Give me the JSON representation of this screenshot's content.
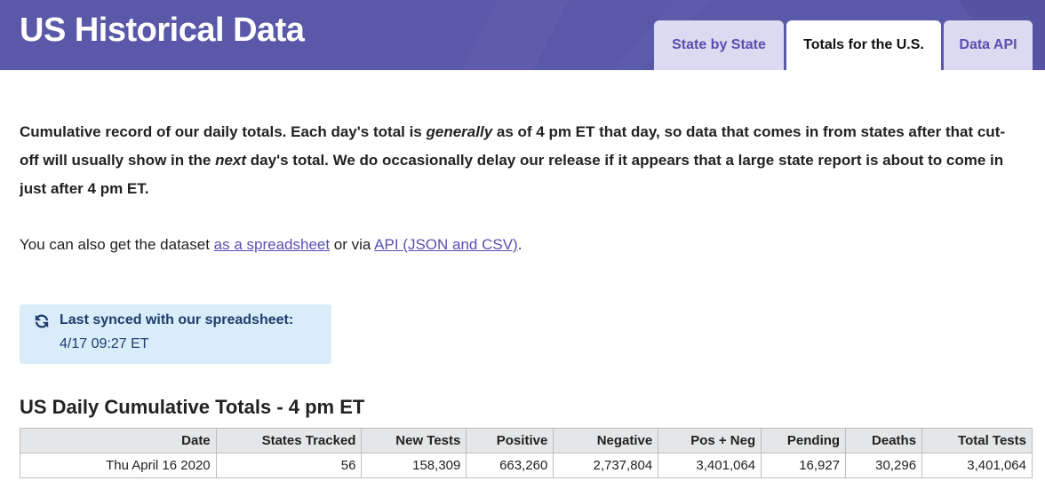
{
  "header": {
    "title": "US Historical Data",
    "tabs": [
      {
        "label": "State by State"
      },
      {
        "label": "Totals for the U.S."
      },
      {
        "label": "Data API"
      }
    ]
  },
  "intro": {
    "p1": "Cumulative record of our daily totals. Each day's total is ",
    "em1": "generally",
    "p2": " as of 4 pm ET that day, so data that comes in from states after that cut-off will usually show in the ",
    "em2": "next",
    "p3": " day's total. We do occasionally delay our release if it appears that a large state report is about to come in just after 4 pm ET."
  },
  "also": {
    "prefix": "You can also get the dataset ",
    "link1": "as a spreadsheet",
    "middle": " or via ",
    "link2": "API (JSON and CSV)",
    "suffix": "."
  },
  "sync": {
    "label": "Last synced with our spreadsheet:",
    "time": "4/17 09:27 ET",
    "icon": "sync-icon"
  },
  "table": {
    "title": "US Daily Cumulative Totals - 4 pm ET",
    "headers": [
      "Date",
      "States Tracked",
      "New Tests",
      "Positive",
      "Negative",
      "Pos + Neg",
      "Pending",
      "Deaths",
      "Total Tests"
    ],
    "rows": [
      [
        "Thu April 16 2020",
        "56",
        "158,309",
        "663,260",
        "2,737,804",
        "3,401,064",
        "16,927",
        "30,296",
        "3,401,064"
      ]
    ]
  },
  "colors": {
    "header_bg": "#5a58a8",
    "tab_inactive_bg": "#dcdaf0",
    "link": "#5a4fb0",
    "sync_bg": "#d9ecf9"
  }
}
